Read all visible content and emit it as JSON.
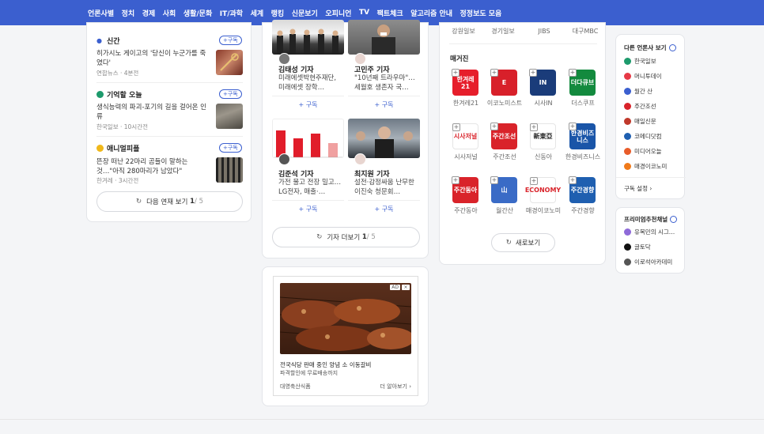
{
  "nav": {
    "items": [
      "언론사별",
      "정치",
      "경제",
      "사회",
      "생활/문화",
      "IT/과학",
      "세계",
      "랭킹",
      "신문보기",
      "오피니언",
      "TV",
      "팩트체크",
      "알고리즘 안내",
      "정정보도 모음"
    ]
  },
  "left_series": {
    "subscribe_label": "+구독",
    "sections": [
      {
        "title": "신간",
        "headline": "히가시노 게이고의 '당신이 누군가를 죽였다'",
        "meta": "연합뉴스 · 4분전"
      },
      {
        "title": "기억할 오늘",
        "headline": "생식능력의 파괴-포기의 길을 걸어온 인류",
        "meta": "한국일보 · 10시간전"
      },
      {
        "title": "애니멀피플",
        "headline": "뜬장 떠난 22마리 곰들이 말하는 것…\"아직 280마리가 남았다\"",
        "meta": "한겨레 · 3시간전"
      }
    ],
    "more_button": {
      "label": "다음 연재 보기",
      "current": "1",
      "total": "/ 5"
    }
  },
  "reporters": {
    "cards": [
      {
        "name": "김태성 기자",
        "desc": "미래에셋박현주재단, 미래에셋 장학…",
        "subscribe": "+ 구독"
      },
      {
        "name": "고민주 기자",
        "desc": "\"10년째 트라우마\"…세월호 생존자 국…",
        "subscribe": "+ 구독"
      },
      {
        "name": "김준석 기자",
        "desc": "가전 물고 전장 밀고… LG전자, 매출·…",
        "subscribe": "+ 구독"
      },
      {
        "name": "최지원 기자",
        "desc": "설전·감정싸움 난무한 이진숙 청문회…",
        "subscribe": "+ 구독"
      }
    ],
    "more_button": {
      "label": "기자 더보기",
      "current": "1",
      "total": "/ 5"
    }
  },
  "ad": {
    "badge": "AD",
    "close": "×",
    "title": "전국식당 판매 중인 양념 소 이동갈비",
    "subtitle": "파격할인에 무료배송까지",
    "advertiser": "대영축산식품",
    "cta": "더 알아보기"
  },
  "press": {
    "top_names": [
      "강원일보",
      "경기일보",
      "JIBS",
      "대구MBC"
    ],
    "magazine_label": "매거진",
    "logos": [
      {
        "text": "한겨레21",
        "name": "한겨레21",
        "color": "#e61e2b"
      },
      {
        "text": "E",
        "name": "이코노미스트",
        "color": "#d8202a"
      },
      {
        "text": "IN",
        "name": "시사IN",
        "color": "#1a3c7a"
      },
      {
        "text": "더다큐브",
        "name": "더스쿠프",
        "color": "#138a3e"
      },
      {
        "text": "시사저널",
        "name": "시사저널",
        "color": "#ffffff"
      },
      {
        "text": "주간조선",
        "name": "주간조선",
        "color": "#d9232a"
      },
      {
        "text": "新東亞",
        "name": "신동아",
        "color": "#ffffff"
      },
      {
        "text": "한경비즈니스",
        "name": "한경비즈니스",
        "color": "#1a55a8"
      },
      {
        "text": "주간동아",
        "name": "주간동아",
        "color": "#d9232a"
      },
      {
        "text": "山",
        "name": "월간산",
        "color": "#3a6bc6"
      },
      {
        "text": "ECONOMY",
        "name": "매경이코노미",
        "color": "#ffffff"
      },
      {
        "text": "주간경향",
        "name": "주간경향",
        "color": "#1f5fb0"
      }
    ],
    "refresh_label": "새로보기"
  },
  "right_sidebar": {
    "other_title": "다른 언론사 보기",
    "other_items": [
      "한국일보",
      "머니투데이",
      "월간 산",
      "주간조선",
      "매일신문",
      "코메디닷컴",
      "미디어오늘",
      "매경이코노미"
    ],
    "settings_label": "구독 설정",
    "premium_title": "프리미엄추천채널",
    "premium_items": [
      "유목민의 시그…",
      "글토닥",
      "이로석아카데미"
    ]
  }
}
